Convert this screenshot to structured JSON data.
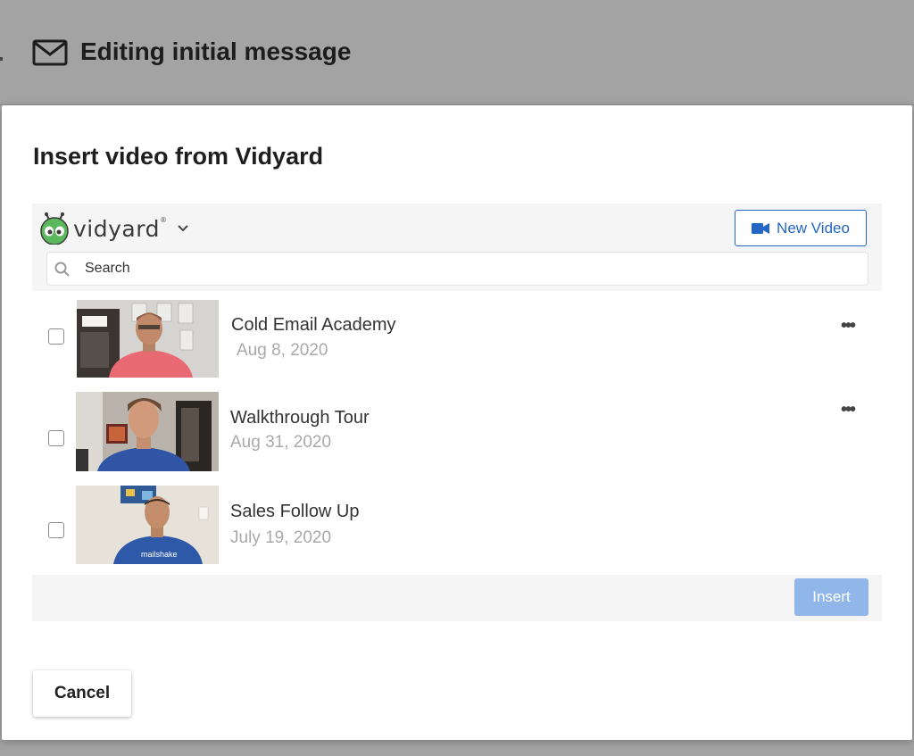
{
  "background": {
    "header_title": "Editing initial message",
    "header_icon": "mail-icon"
  },
  "modal": {
    "title": "Insert video from Vidyard",
    "cancel_label": "Cancel"
  },
  "vidyard": {
    "logo_text": "vidyard",
    "logo_reg": "®",
    "new_video_label": "New Video",
    "search_placeholder": "Search",
    "insert_label": "Insert",
    "videos": [
      {
        "title": "Cold Email Academy",
        "date": "Aug 8, 2020",
        "has_menu": true
      },
      {
        "title": "Walkthrough Tour",
        "date": "Aug 31, 2020",
        "has_menu": true
      },
      {
        "title": "Sales Follow Up",
        "date": "July 19, 2020",
        "has_menu": false
      }
    ]
  },
  "colors": {
    "accent_blue": "#2566c5",
    "insert_disabled": "#90b6ea",
    "vidyard_green": "#5cb85c",
    "overlay_gray": "#a3a3a3"
  }
}
